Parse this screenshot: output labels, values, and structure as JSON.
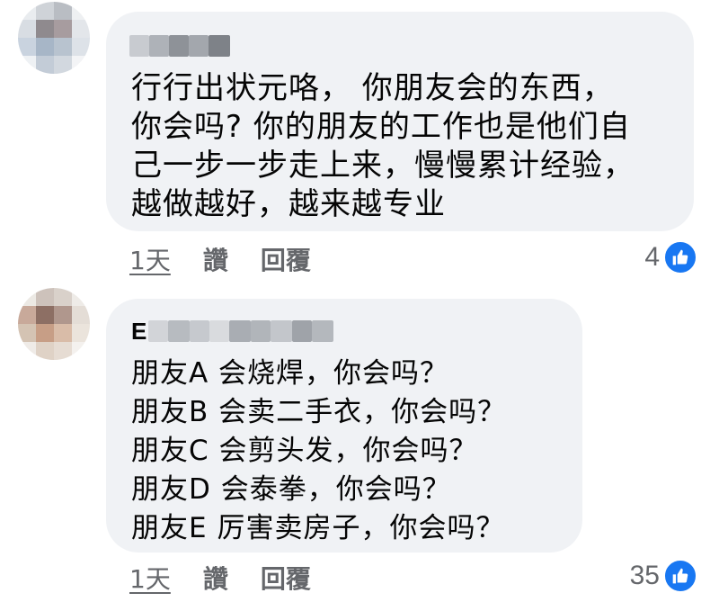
{
  "colors": {
    "bubble_bg": "#f0f2f5",
    "text": "#050505",
    "secondary_text": "#65676b",
    "like_blue": "#1877f2"
  },
  "comments": [
    {
      "author_initial": "",
      "author_redacted": true,
      "text": "行行出状元咯， 你朋友会的东西，\n你会吗? 你的朋友的工作也是他们自\n己一步一步走上来，慢慢累计经验，\n越做越好，越来越专业",
      "timestamp": "1天",
      "like_label": "讚",
      "reply_label": "回覆",
      "reaction_count": "4",
      "reaction_icon": "like-thumbs-up-icon"
    },
    {
      "author_initial": "E",
      "author_redacted": true,
      "text": "朋友A 会烧焊，你会吗？\n朋友B 会卖二手衣，你会吗？\n朋友C 会剪头发，你会吗？\n朋友D 会泰拳，你会吗？\n朋友E 厉害卖房子，你会吗？",
      "timestamp": "1天",
      "like_label": "讚",
      "reply_label": "回覆",
      "reaction_count": "35",
      "reaction_icon": "like-thumbs-up-icon"
    }
  ]
}
